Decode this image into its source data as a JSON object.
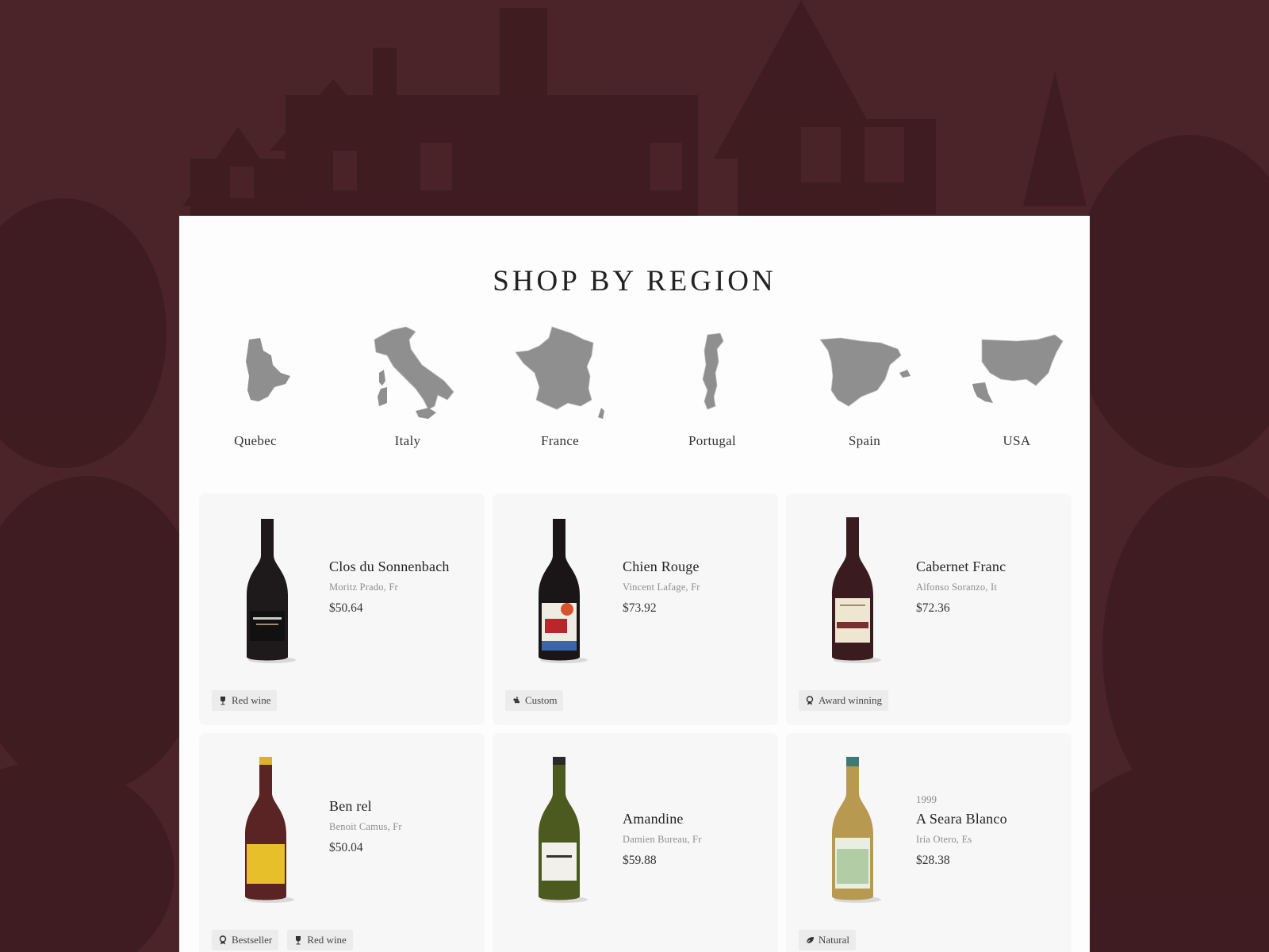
{
  "page": {
    "title": "SHOP BY REGION"
  },
  "colors": {
    "backdrop": "#4a2428",
    "panel": "#fdfdfd",
    "card": "#f7f7f7",
    "map_fill": "#8f8f8f",
    "tag_bg": "#ececec"
  },
  "regions": [
    {
      "label": "Quebec",
      "icon": "quebec-map-icon"
    },
    {
      "label": "Italy",
      "icon": "italy-map-icon"
    },
    {
      "label": "France",
      "icon": "france-map-icon"
    },
    {
      "label": "Portugal",
      "icon": "portugal-map-icon"
    },
    {
      "label": "Spain",
      "icon": "spain-map-icon"
    },
    {
      "label": "USA",
      "icon": "usa-map-icon"
    }
  ],
  "products": [
    {
      "year": "",
      "name": "Clos du Sonnenbach",
      "maker": "Moritz Prado, Fr",
      "price": "$50.64",
      "tags": [
        {
          "label": "Red wine",
          "icon": "wine-glass-icon"
        }
      ]
    },
    {
      "year": "",
      "name": "Chien Rouge",
      "maker": "Vincent Lafage, Fr",
      "price": "$73.92",
      "tags": [
        {
          "label": "Custom",
          "icon": "grapes-icon"
        }
      ]
    },
    {
      "year": "",
      "name": "Cabernet Franc",
      "maker": "Alfonso Soranzo, It",
      "price": "$72.36",
      "tags": [
        {
          "label": "Award winning",
          "icon": "award-icon"
        }
      ]
    },
    {
      "year": "",
      "name": "Ben rel",
      "maker": "Benoit Camus, Fr",
      "price": "$50.04",
      "tags": [
        {
          "label": "Bestseller",
          "icon": "award-icon"
        },
        {
          "label": "Red wine",
          "icon": "wine-glass-icon"
        }
      ]
    },
    {
      "year": "",
      "name": "Amandine",
      "maker": "Damien Bureau, Fr",
      "price": "$59.88",
      "tags": []
    },
    {
      "year": "1999",
      "name": "A Seara Blanco",
      "maker": "Iria Otero, Es",
      "price": "$28.38",
      "tags": [
        {
          "label": "Natural",
          "icon": "leaf-icon"
        }
      ]
    }
  ]
}
